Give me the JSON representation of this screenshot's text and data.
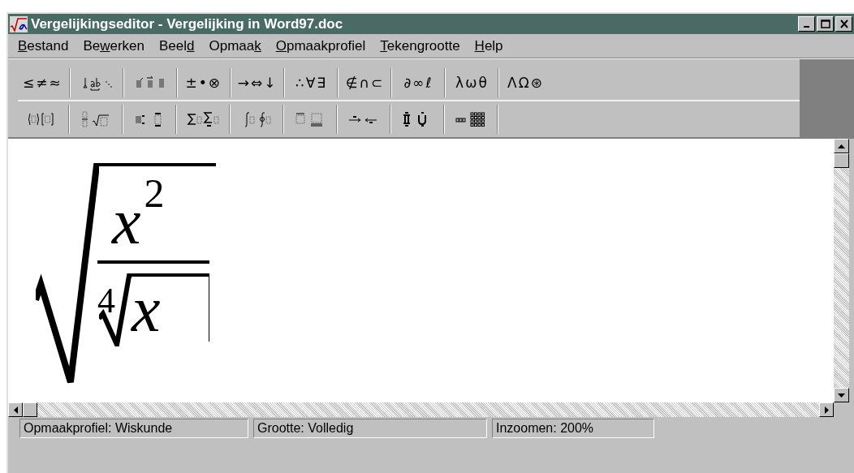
{
  "window": {
    "title": "Vergelijkingseditor - Vergelijking in Word97.doc"
  },
  "menu": [
    {
      "key": "B",
      "post": "estand"
    },
    {
      "pre": "Be",
      "key": "w",
      "post": "erken"
    },
    {
      "pre": "Beel",
      "key": "d"
    },
    {
      "pre": "Opmaa",
      "key": "k"
    },
    {
      "key": "O",
      "post": "pmaakprofiel"
    },
    {
      "key": "T",
      "post": "ekengrootte"
    },
    {
      "key": "H",
      "post": "elp"
    }
  ],
  "toolbar_rows": [
    [
      {
        "kind": "symbols",
        "label": "≤≠≈"
      },
      {
        "kind": "template"
      },
      {
        "kind": "template"
      },
      {
        "kind": "symbols",
        "label": "±•⊗"
      },
      {
        "kind": "symbols",
        "label": "→⇔↓"
      },
      {
        "kind": "symbols",
        "label": "∴∀∃"
      },
      {
        "kind": "symbols",
        "label": "∉∩⊂"
      },
      {
        "kind": "symbols",
        "label": "∂∞ℓ"
      },
      {
        "kind": "symbols",
        "label": "λωθ"
      },
      {
        "kind": "symbols",
        "label": "ΛΩ⊛"
      }
    ],
    [
      {
        "kind": "template"
      },
      {
        "kind": "template"
      },
      {
        "kind": "template"
      },
      {
        "kind": "template"
      },
      {
        "kind": "template"
      },
      {
        "kind": "template"
      },
      {
        "kind": "template"
      },
      {
        "kind": "template"
      },
      {
        "kind": "template"
      }
    ]
  ],
  "equation": {
    "numerator_base": "x",
    "numerator_exponent": "2",
    "root_index": "4",
    "radicand": "x"
  },
  "status_bar": [
    "Opmaakprofiel: Wiskunde",
    "Grootte: Volledig",
    "Inzoomen: 200%"
  ]
}
